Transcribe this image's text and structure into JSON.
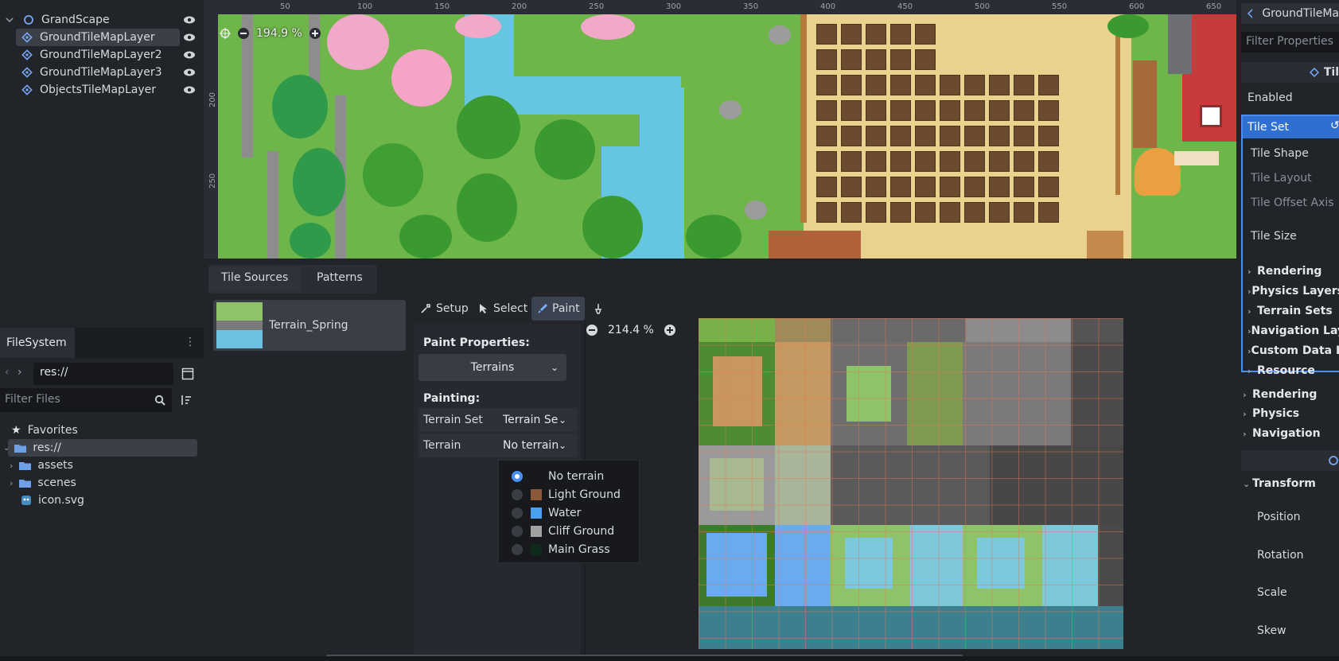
{
  "scene_tree": {
    "root": "GrandScape",
    "children": [
      "GroundTileMapLayer",
      "GroundTileMapLayer2",
      "GroundTileMapLayer3",
      "ObjectsTileMapLayer"
    ]
  },
  "filesystem": {
    "tab": "FileSystem",
    "path": "res://",
    "filter_placeholder": "Filter Files",
    "items": [
      {
        "label": "Favorites",
        "icon": "star-icon"
      },
      {
        "label": "res://",
        "icon": "folder-icon"
      },
      {
        "label": "assets",
        "icon": "folder-icon"
      },
      {
        "label": "scenes",
        "icon": "folder-icon"
      },
      {
        "label": "icon.svg",
        "icon": "godot-file-icon"
      }
    ]
  },
  "viewport": {
    "zoom": "194.9 %",
    "ruler_x": [
      "50",
      "100",
      "150",
      "200",
      "250",
      "300",
      "350",
      "400",
      "450",
      "500",
      "550",
      "600",
      "650"
    ],
    "ruler_y": [
      "200",
      "250"
    ]
  },
  "tile_panel": {
    "tabs": [
      "Tile Sources",
      "Patterns"
    ],
    "source_name": "Terrain_Spring",
    "tools": {
      "setup": "Setup",
      "select": "Select",
      "paint": "Paint"
    },
    "paint_properties_label": "Paint Properties:",
    "paint_mode": "Terrains",
    "painting_label": "Painting:",
    "terrain_set_label": "Terrain Set",
    "terrain_set_value": "Terrain Se",
    "terrain_label": "Terrain",
    "terrain_value": "No terrain",
    "atlas_zoom": "214.4 %",
    "terrain_options": [
      {
        "label": "No terrain",
        "color": "",
        "selected": true
      },
      {
        "label": "Light Ground",
        "color": "#8a5a3a",
        "selected": false
      },
      {
        "label": "Water",
        "color": "#4aa0f0",
        "selected": false
      },
      {
        "label": "Cliff Ground",
        "color": "#a0a0a0",
        "selected": false
      },
      {
        "label": "Main Grass",
        "color": "#0d2a1a",
        "selected": false
      }
    ]
  },
  "inspector": {
    "title": "GroundTileMa",
    "filter_placeholder": "Filter Properties",
    "section_header": "Til",
    "props": {
      "enabled": "Enabled",
      "tile_set": "Tile Set",
      "tile_shape": "Tile Shape",
      "tile_layout": "Tile Layout",
      "tile_offset_axis": "Tile Offset Axis",
      "tile_size": "Tile Size"
    },
    "subsections": [
      "Rendering",
      "Physics Layers",
      "Terrain Sets",
      "Navigation Lay",
      "Custom Data La",
      "Resource"
    ],
    "sections": [
      "Rendering",
      "Physics",
      "Navigation"
    ],
    "transform": {
      "label": "Transform",
      "fields": [
        "Position",
        "Rotation",
        "Scale",
        "Skew"
      ]
    }
  },
  "colors": {
    "accent": "#4a8ef0",
    "panel": "#212429",
    "grass": "#6fb64a",
    "water": "#66c6e0"
  }
}
